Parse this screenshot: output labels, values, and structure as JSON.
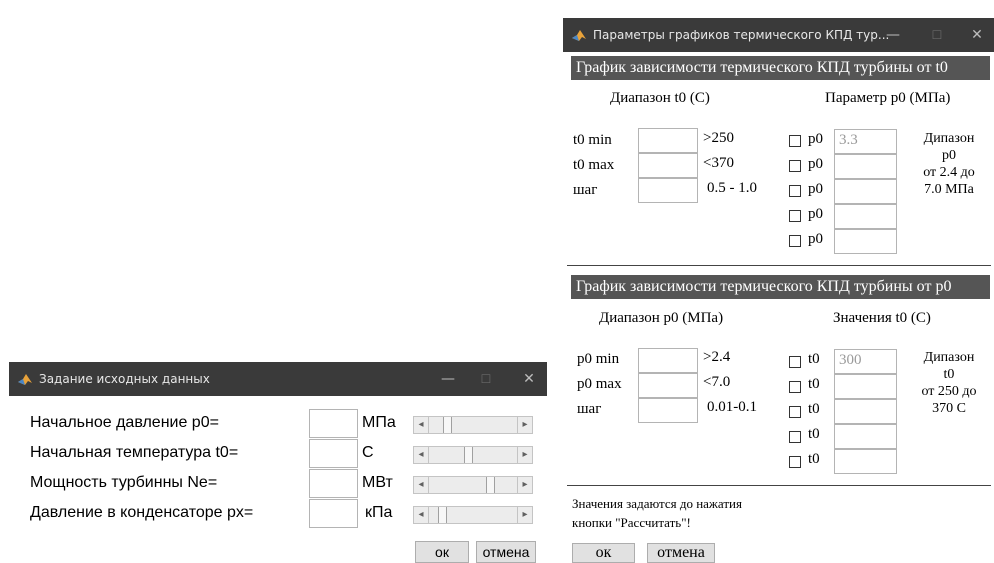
{
  "window1": {
    "title": "Задание исходных данных",
    "rows": [
      {
        "label": "Начальное давление p0=",
        "value": "",
        "unit": "МПа",
        "level": 0.18
      },
      {
        "label": "Начальная температура t0=",
        "value": "",
        "unit": "С",
        "level": 0.45
      },
      {
        "label": "Мощность турбинны Ne=",
        "value": "",
        "unit": "МВт",
        "level": 0.72
      },
      {
        "label": "Давление в конденсаторе px=",
        "value": "",
        "unit": "кПа",
        "level": 0.12
      }
    ],
    "ok": "ок",
    "cancel": "отмена"
  },
  "window2": {
    "title": "Параметры графиков термического КПД тур...",
    "section1": {
      "banner": "График зависимости термического КПД турбины от t0",
      "range_header": "Диапазон  t0 (С)",
      "param_header": "Параметр  p0 (МПа)",
      "rows": [
        {
          "label": "t0 min",
          "value": "",
          "hint": ">250"
        },
        {
          "label": "t0 max",
          "value": "",
          "hint": "<370"
        },
        {
          "label": "шаг",
          "value": "",
          "hint": "0.5 - 1.0"
        }
      ],
      "param_label": "p0",
      "params": [
        "3.3",
        "",
        "",
        "",
        ""
      ],
      "note": [
        "Дипазон",
        "p0",
        "от 2.4 до",
        "7.0 МПа"
      ]
    },
    "section2": {
      "banner": "График зависимости термического КПД турбины от p0",
      "range_header": "Диапазон p0 (МПа)",
      "param_header": "Значения  t0 (С)",
      "rows": [
        {
          "label": "p0 min",
          "value": "",
          "hint": ">2.4"
        },
        {
          "label": "p0 max",
          "value": "",
          "hint": "<7.0"
        },
        {
          "label": "шаг",
          "value": "",
          "hint": "0.01-0.1"
        }
      ],
      "param_label": "t0",
      "params": [
        "300",
        "",
        "",
        "",
        ""
      ],
      "note": [
        "Дипазон",
        "t0",
        "от 250 до",
        "370 С"
      ]
    },
    "footnote": [
      "Значения задаются до нажатия",
      "кнопки \"Рассчитать\"!"
    ],
    "ok": "ок",
    "cancel": "отмена"
  },
  "icons": {
    "app": "matlab-icon",
    "minimize": "—",
    "maximize": "☐",
    "close": "✕"
  }
}
